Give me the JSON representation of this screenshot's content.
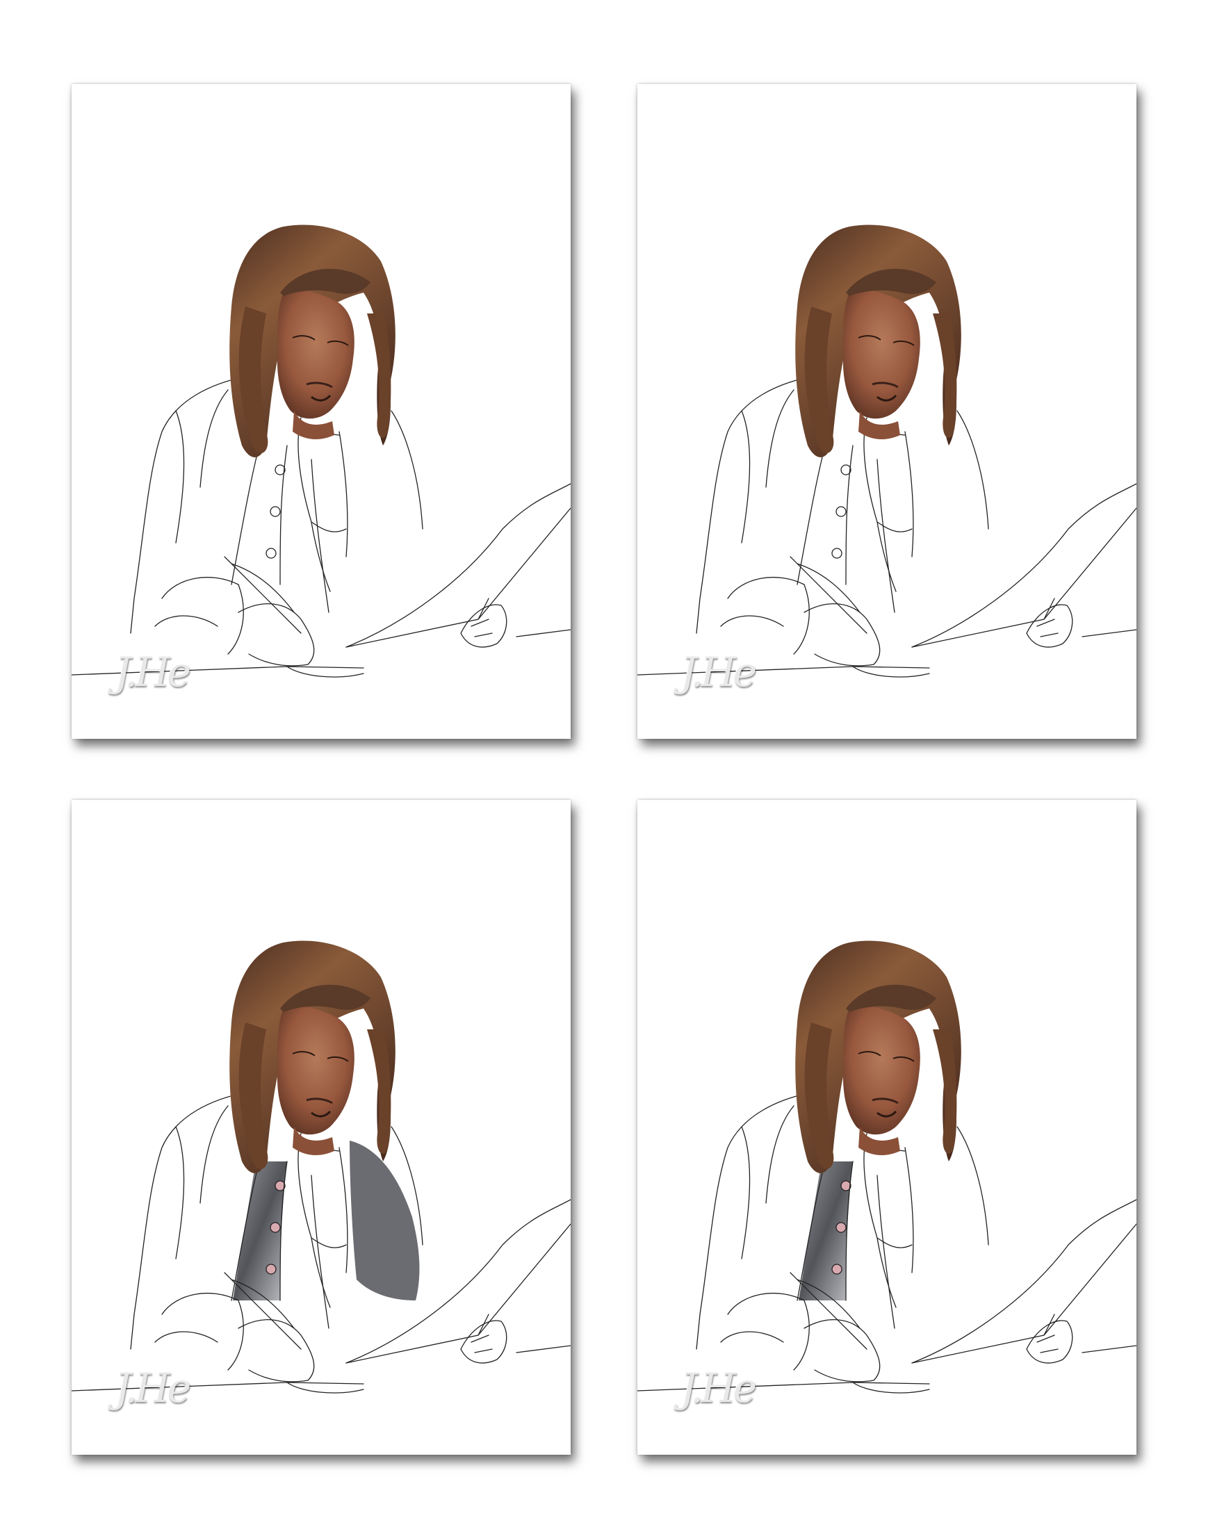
{
  "title": "",
  "panels": [
    {
      "step": 1,
      "hair": true,
      "skin": true,
      "vest_left": false,
      "vest_right": false
    },
    {
      "step": 2,
      "hair": true,
      "skin": true,
      "vest_left": false,
      "vest_right": false
    },
    {
      "step": 3,
      "hair": true,
      "skin": true,
      "vest_left": true,
      "vest_right": true
    },
    {
      "step": 4,
      "hair": true,
      "skin": true,
      "vest_left": true,
      "vest_right": false
    }
  ],
  "signature": "J.He",
  "colors": {
    "hair": "#5e3a28",
    "hair_highlight": "#8a5a3a",
    "skin": "#a86a4c",
    "skin_shadow": "#6e3f2b",
    "line": "#222222",
    "vest": "#4a4c52",
    "vest_light": "#9a9ca2",
    "shadow": "rgba(0,0,0,0.55)"
  }
}
